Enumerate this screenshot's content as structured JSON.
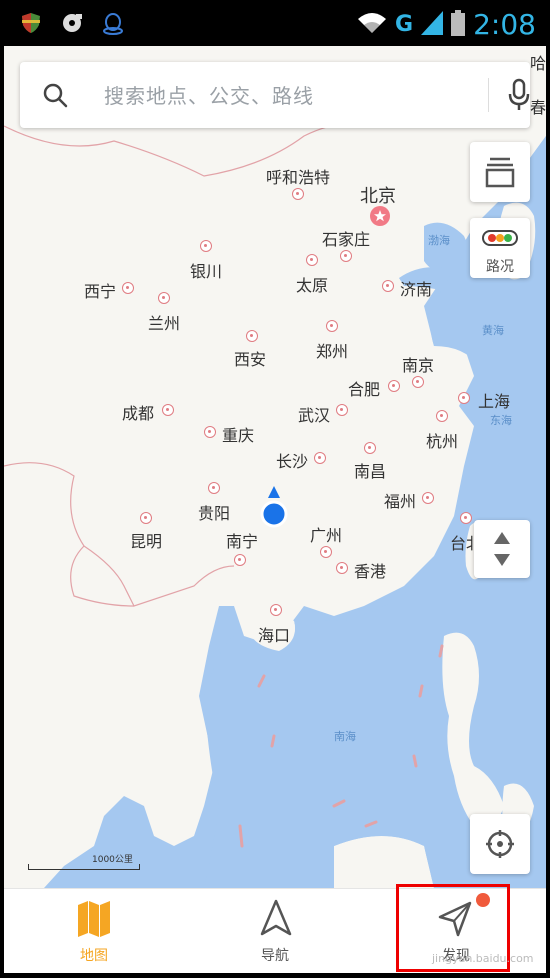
{
  "status_bar": {
    "network": "G",
    "time": "2:08"
  },
  "search": {
    "placeholder": "搜索地点、公交、路线"
  },
  "controls": {
    "layers": "图层",
    "traffic_label": "路况"
  },
  "map": {
    "capital": "北京",
    "cities": [
      {
        "name": "呼和浩特"
      },
      {
        "name": "石家庄"
      },
      {
        "name": "太原"
      },
      {
        "name": "济南"
      },
      {
        "name": "银川"
      },
      {
        "name": "西宁"
      },
      {
        "name": "兰州"
      },
      {
        "name": "西安"
      },
      {
        "name": "郑州"
      },
      {
        "name": "南京"
      },
      {
        "name": "合肥"
      },
      {
        "name": "上海"
      },
      {
        "name": "成都"
      },
      {
        "name": "武汉"
      },
      {
        "name": "杭州"
      },
      {
        "name": "重庆"
      },
      {
        "name": "长沙"
      },
      {
        "name": "南昌"
      },
      {
        "name": "贵阳"
      },
      {
        "name": "福州"
      },
      {
        "name": "昆明"
      },
      {
        "name": "南宁"
      },
      {
        "name": "广州"
      },
      {
        "name": "香港"
      },
      {
        "name": "海口"
      },
      {
        "name": "台北"
      }
    ],
    "seas": [
      "渤海",
      "黄海",
      "东海",
      "南海"
    ],
    "edge_labels": [
      "哈",
      "春"
    ],
    "scale_label": "1000公里"
  },
  "bottom_nav": {
    "items": [
      {
        "label": "地图",
        "active": true
      },
      {
        "label": "导航",
        "active": false
      },
      {
        "label": "发现",
        "active": false
      }
    ]
  },
  "watermark": "jingyan.baidu.com",
  "colors": {
    "active": "#f5a623",
    "inactive": "#555555",
    "location": "#1a73e8",
    "badge": "#f05a3c"
  }
}
